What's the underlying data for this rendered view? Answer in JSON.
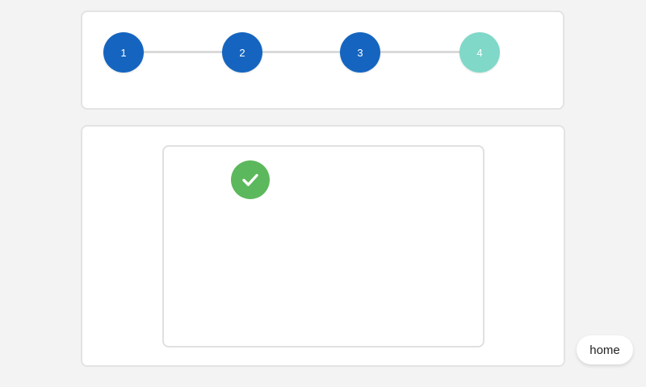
{
  "stepper": {
    "steps": [
      {
        "label": "1",
        "state": "complete"
      },
      {
        "label": "2",
        "state": "complete"
      },
      {
        "label": "3",
        "state": "complete"
      },
      {
        "label": "4",
        "state": "current"
      }
    ]
  },
  "colors": {
    "step_complete": "#1565c0",
    "step_current": "#80d8c8",
    "connector": "#d9d9d9",
    "success": "#5cb85c",
    "background": "#f3f3f3",
    "card": "#ffffff"
  },
  "icons": {
    "success": "check-icon"
  },
  "home_button": {
    "label": "home"
  }
}
